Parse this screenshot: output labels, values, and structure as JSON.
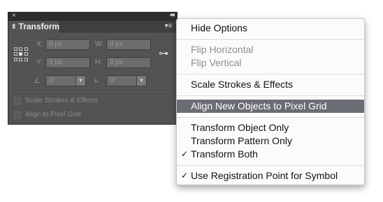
{
  "panel": {
    "tab_label": "Transform",
    "close_glyph": "×",
    "collapse_glyph": "◂◂",
    "menu_glyph": "▾≡",
    "x_label": "X:",
    "x_value": "0 px",
    "y_label": "Y:",
    "y_value": "0 px",
    "w_label": "W:",
    "w_value": "0 px",
    "h_label": "H:",
    "h_value": "0 px",
    "rotate_value": "0°",
    "shear_value": "0°",
    "scale_strokes_label": "Scale Strokes & Effects",
    "align_pixel_label": "Align to Pixel Grid",
    "link_icon": "constrain-proportions-icon"
  },
  "menu": {
    "items": [
      {
        "label": "Hide Options",
        "enabled": true
      },
      {
        "label": "Flip Horizontal",
        "enabled": false
      },
      {
        "label": "Flip Vertical",
        "enabled": false
      },
      {
        "label": "Scale Strokes & Effects",
        "enabled": true
      },
      {
        "label": "Align New Objects to Pixel Grid",
        "enabled": true,
        "highlighted": true
      },
      {
        "label": "Transform Object Only",
        "enabled": true
      },
      {
        "label": "Transform Pattern Only",
        "enabled": true
      },
      {
        "label": "Transform Both",
        "enabled": true,
        "checked": true
      },
      {
        "label": "Use Registration Point for Symbol",
        "enabled": true,
        "checked": true
      }
    ],
    "check_glyph": "✓"
  },
  "colors": {
    "panel_bg": "#535353",
    "menu_highlight": "#6b6d74"
  }
}
